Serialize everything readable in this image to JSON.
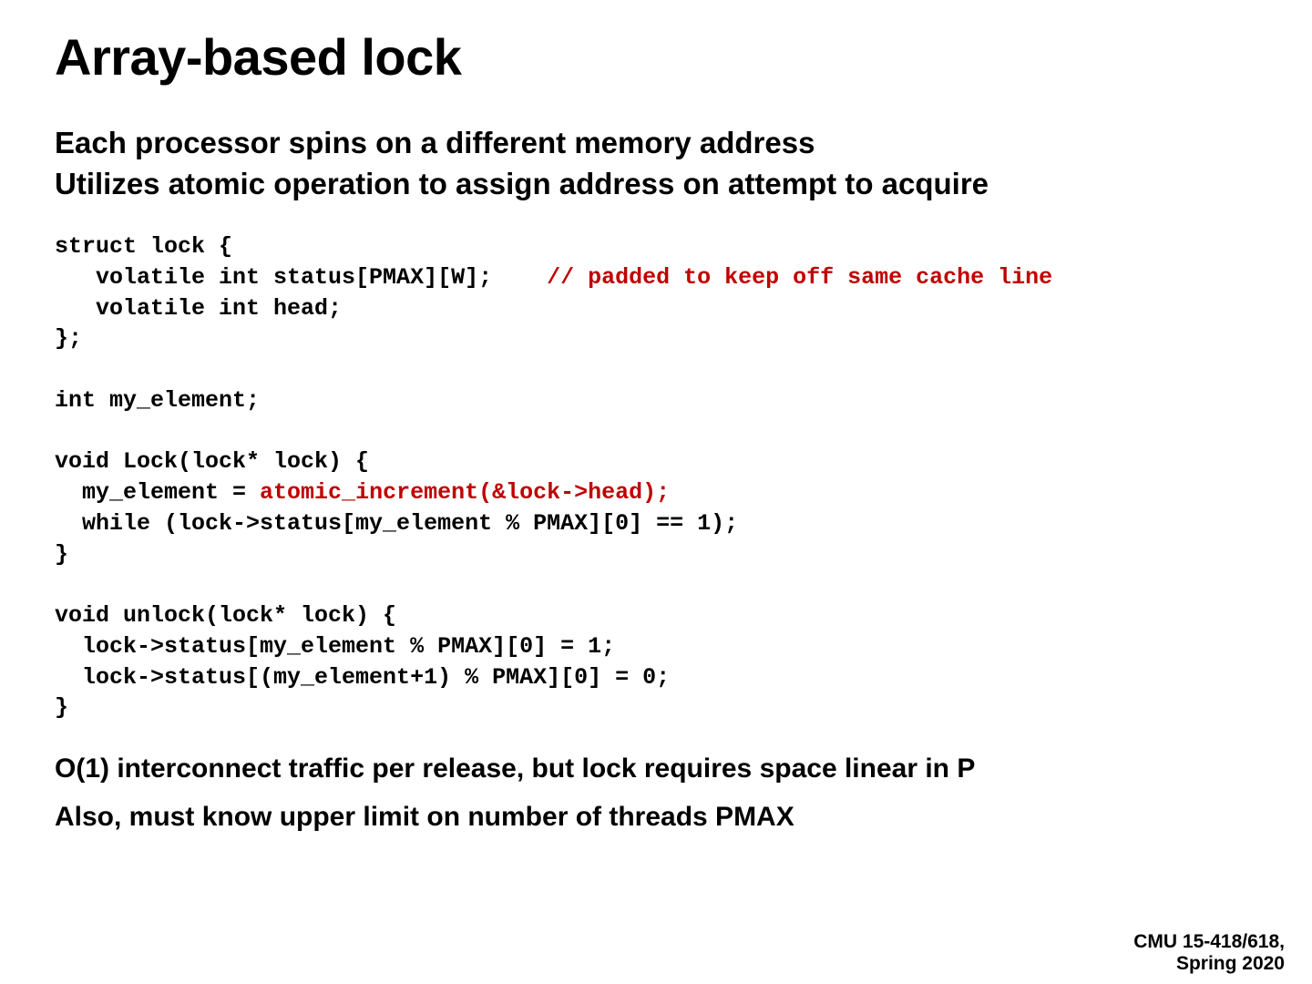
{
  "title": "Array-based lock",
  "subtitle_l1": "Each processor spins on a different memory address",
  "subtitle_l2": "Utilizes atomic operation to assign address on attempt to acquire",
  "code": {
    "l1": "struct lock {",
    "l2a": "   volatile int status[PMAX][W];    ",
    "l2b": "// padded to keep off same cache line",
    "l3": "   volatile int head;",
    "l4": "};",
    "l5": "",
    "l6": "int my_element;",
    "l7": "",
    "l8": "void Lock(lock* lock) {",
    "l9a": "  my_element = ",
    "l9b": "atomic_increment(&lock->head);",
    "l10": "  while (lock->status[my_element % PMAX][0] == 1);",
    "l11": "}",
    "l12": "",
    "l13": "void unlock(lock* lock) {",
    "l14": "  lock->status[my_element % PMAX][0] = 1;",
    "l15": "  lock->status[(my_element+1) % PMAX][0] = 0;",
    "l16": "}"
  },
  "note1": "O(1) interconnect traffic per release, but lock requires space linear in P",
  "note2": "Also, must know upper limit on number of threads PMAX",
  "footer_l1": "CMU 15-418/618,",
  "footer_l2": "Spring 2020"
}
